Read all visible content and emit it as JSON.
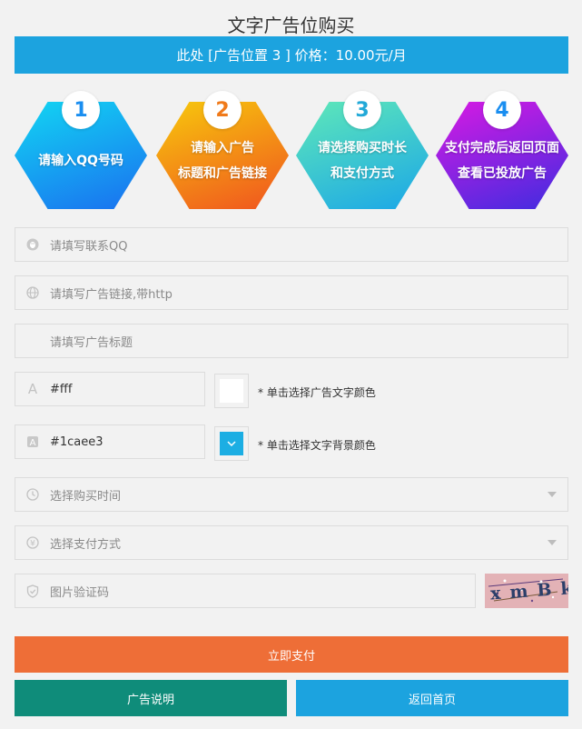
{
  "page": {
    "title": "文字广告位购买",
    "price_bar": "此处 [广告位置 3 ] 价格：10.00元/月"
  },
  "steps": [
    {
      "num": "1",
      "line1": "请输入QQ号码",
      "line2": "",
      "color_top": "#12d6f2",
      "color_bottom": "#1a6ff0",
      "num_color": "#1a8ef0"
    },
    {
      "num": "2",
      "line1": "请输入广告",
      "line2": "标题和广告链接",
      "color_top": "#f7c90c",
      "color_bottom": "#f0531f",
      "num_color": "#f07a1a"
    },
    {
      "num": "3",
      "line1": "请选择购买时长",
      "line2": "和支付方式",
      "color_top": "#5fe8b8",
      "color_bottom": "#1aa6e8",
      "num_color": "#22a9d8"
    },
    {
      "num": "4",
      "line1": "支付完成后返回页面",
      "line2": "查看已投放广告",
      "color_top": "#d81ae3",
      "color_bottom": "#3f2ce0",
      "num_color": "#1a8ef0"
    }
  ],
  "form": {
    "qq": {
      "placeholder": "请填写联系QQ",
      "icon": "qq-penguin-icon"
    },
    "link": {
      "placeholder": "请填写广告链接,带http",
      "icon": "globe-icon"
    },
    "ad_title": {
      "placeholder": "请填写广告标题"
    },
    "text_color": {
      "value": "#fff",
      "icon": "font-icon",
      "hint": "* 单击选择广告文字颜色",
      "swatch": "#ffffff"
    },
    "bg_color": {
      "value": "#1caee3",
      "icon": "font-filled-icon",
      "hint": "* 单击选择文字背景颜色",
      "swatch": "#1caee3"
    },
    "duration": {
      "placeholder": "选择购买时间",
      "icon": "clock-icon"
    },
    "payment": {
      "placeholder": "选择支付方式",
      "icon": "yen-icon"
    },
    "captcha": {
      "placeholder": "图片验证码",
      "icon": "shield-icon",
      "image_text": "xmBk"
    }
  },
  "buttons": {
    "pay": {
      "label": "立即支付",
      "color": "#ee6e37"
    },
    "about": {
      "label": "广告说明",
      "color": "#0f8c7a"
    },
    "home": {
      "label": "返回首页",
      "color": "#1ca3df"
    }
  }
}
